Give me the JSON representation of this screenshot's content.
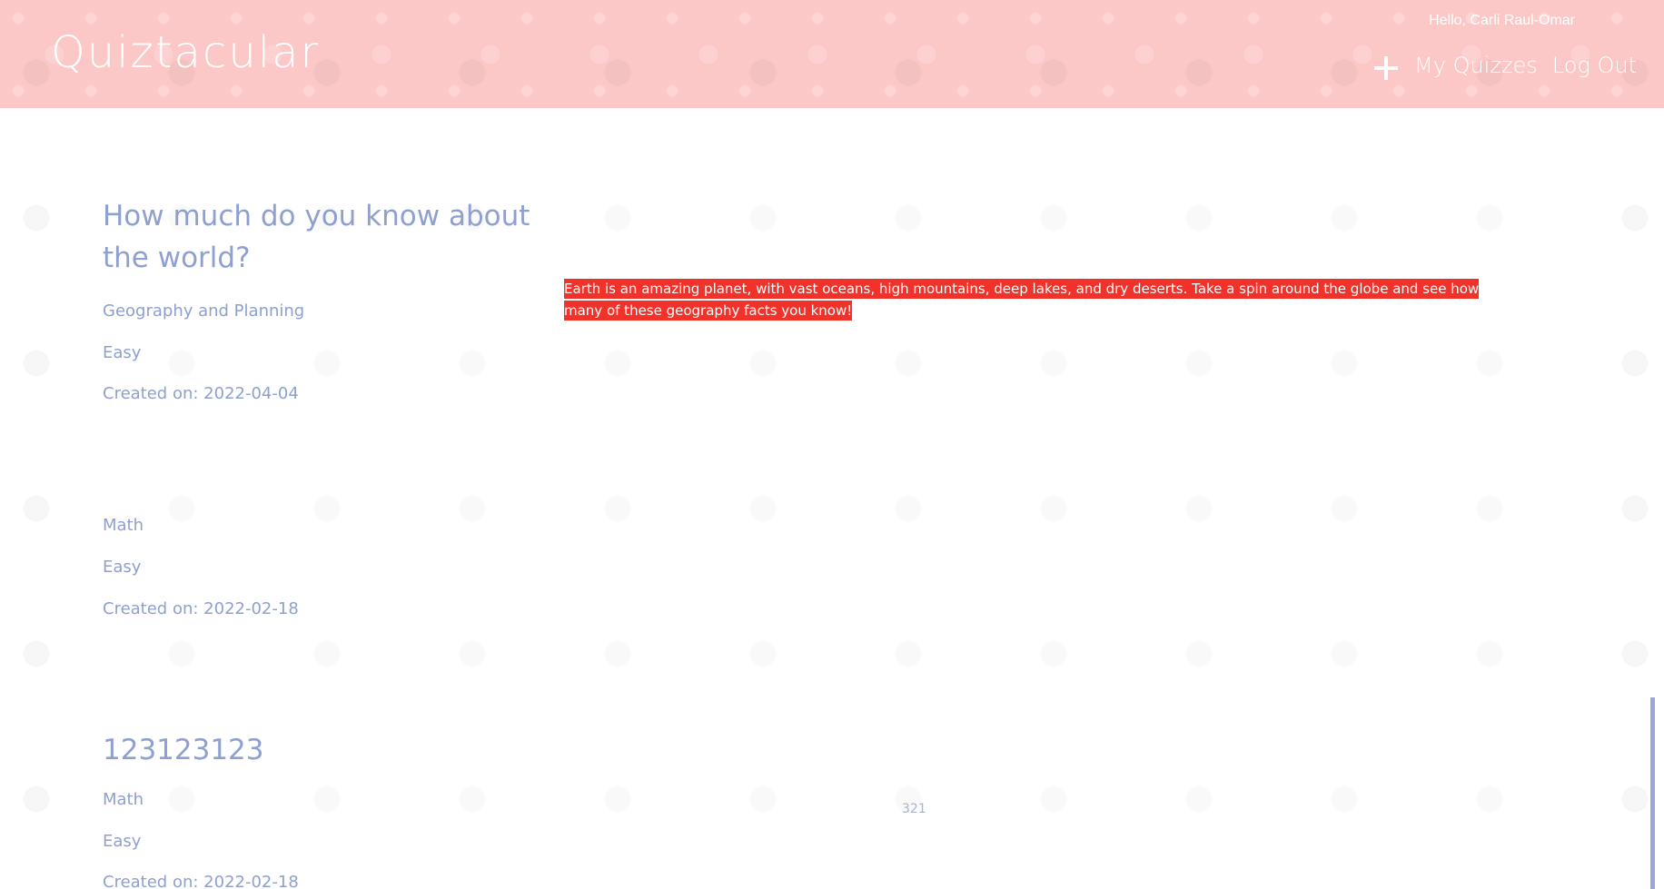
{
  "header": {
    "logo": "Quiztacular",
    "greeting": "Hello, Carli Raul-Omar",
    "nav": {
      "my_quizzes": "My Quizzes",
      "log_out": "Log Out"
    }
  },
  "quizzes": [
    {
      "title": "How much do you know about the world?",
      "category": "Geography and Planning",
      "difficulty": "Easy",
      "created": "Created on: 2022-04-04",
      "description": "Earth is an amazing planet, with vast oceans, high mountains, deep lakes, and dry deserts. Take a spin around the globe and see how many of these geography facts you know!"
    },
    {
      "title": "",
      "category": "Math",
      "difficulty": "Easy",
      "created": "Created on: 2022-02-18",
      "description": ""
    },
    {
      "title": "123123123",
      "category": "Math",
      "difficulty": "Easy",
      "created": "Created on: 2022-02-18",
      "description": "321"
    }
  ],
  "colors": {
    "header_bg": "#fcc7c7",
    "text_muted": "#8ea0cf",
    "highlight": "#f0322a"
  },
  "icons": {
    "add": "plus-icon",
    "play": "play-icon",
    "share": "share-icon"
  }
}
